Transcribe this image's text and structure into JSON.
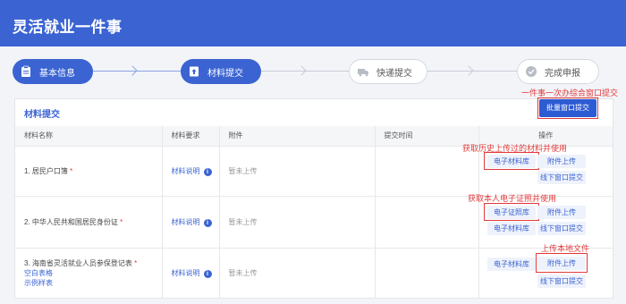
{
  "header": {
    "title": "灵活就业一件事"
  },
  "steps": [
    {
      "label": "基本信息",
      "icon": "clipboard-icon",
      "state": "active"
    },
    {
      "label": "材料提交",
      "icon": "upload-doc-icon",
      "state": "active"
    },
    {
      "label": "快递提交",
      "icon": "truck-icon",
      "state": "inactive"
    },
    {
      "label": "完成申报",
      "icon": "check-circle-icon",
      "state": "inactive"
    }
  ],
  "panel": {
    "title": "材料提交",
    "batch_button": "批量窗口提交",
    "note_batch": "一件事一次办综合窗口提交",
    "columns": [
      "材料名称",
      "材料要求",
      "附件",
      "提交时间",
      "操作"
    ],
    "rows": [
      {
        "name": "1. 居民户口簿",
        "required": "*",
        "req_link": "材料说明",
        "attachment": "暂未上传",
        "time": "",
        "actions": [
          "电子材料库",
          "附件上传",
          "线下窗口提交"
        ]
      },
      {
        "name": "2. 中华人民共和国居民身份证",
        "required": "*",
        "req_link": "材料说明",
        "attachment": "暂未上传",
        "time": "",
        "actions": [
          "电子证照库",
          "附件上传",
          "电子材料库",
          "线下窗口提交"
        ]
      },
      {
        "name": "3. 海南省灵活就业人员参保登记表",
        "required": "*",
        "links": [
          "空白表格",
          "示例样表"
        ],
        "req_link": "材料说明",
        "attachment": "暂未上传",
        "time": "",
        "actions": [
          "电子材料库",
          "附件上传",
          "线下窗口提交"
        ]
      }
    ],
    "notes": {
      "history": "获取历史上传过的材料并使用",
      "license": "获取本人电子证照并使用",
      "local": "上传本地文件"
    }
  },
  "colors": {
    "primary": "#3b64d2",
    "annotation": "#e23a3a"
  }
}
